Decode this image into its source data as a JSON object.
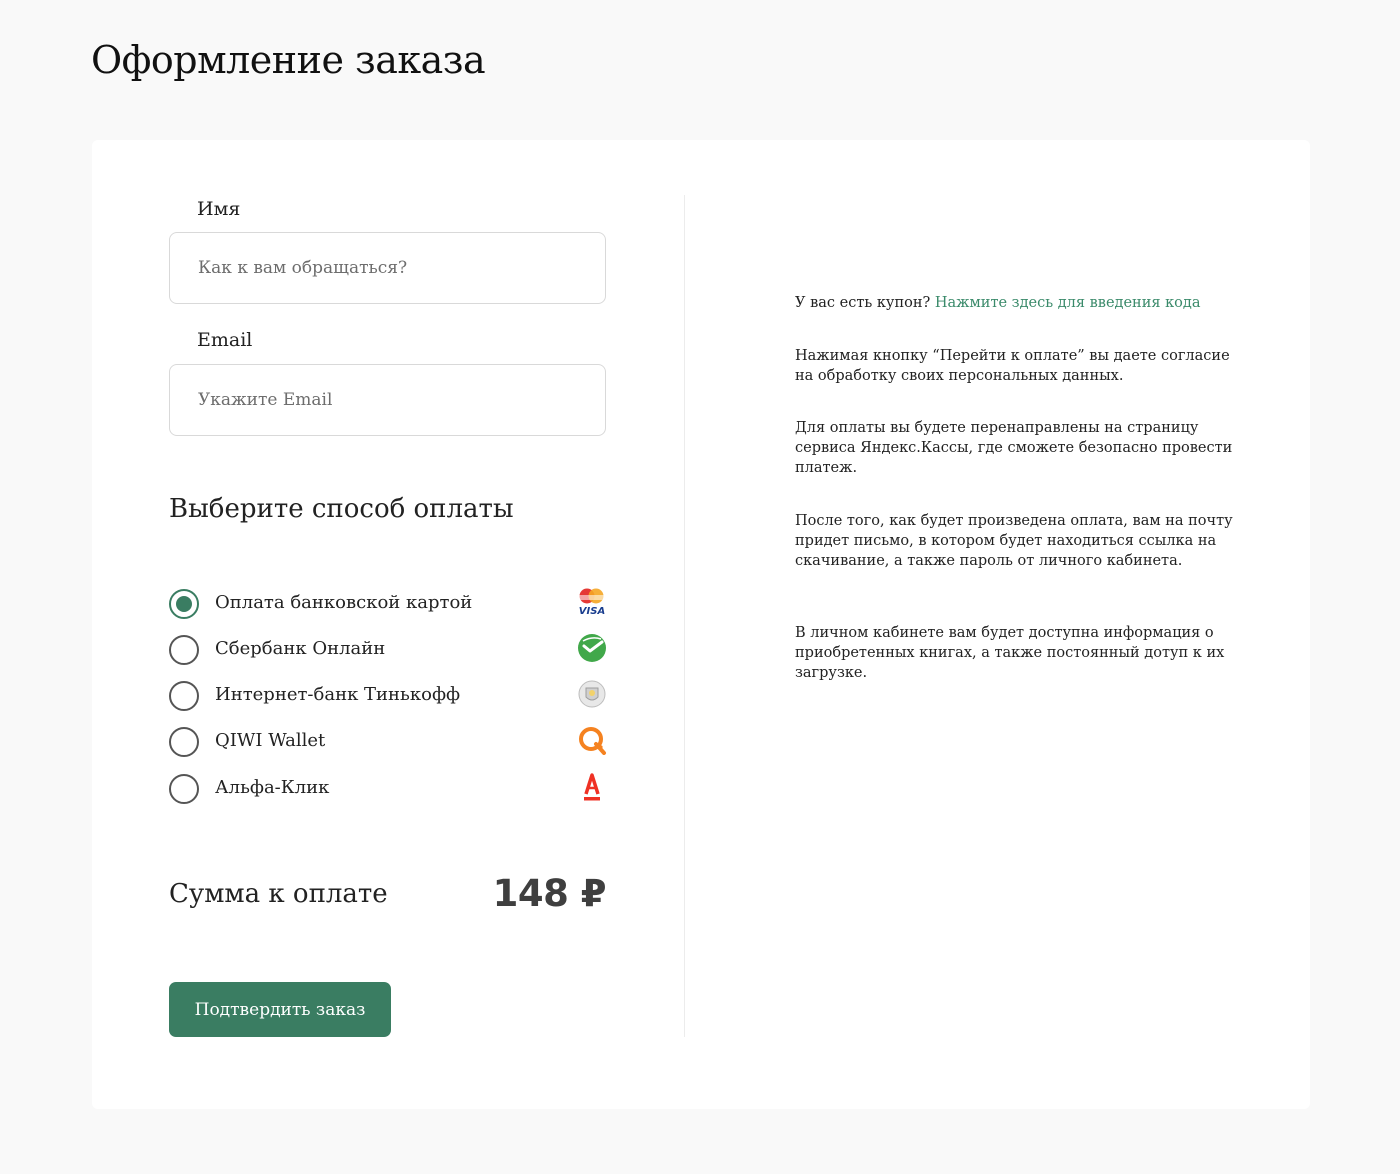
{
  "page": {
    "title": "Оформление заказа"
  },
  "form": {
    "name_label": "Имя",
    "name_placeholder": "Как к вам обращаться?",
    "name_value": "",
    "email_label": "Email",
    "email_placeholder": "Укажите Email",
    "email_value": ""
  },
  "payment": {
    "title": "Выберите способ оплаты",
    "selected_index": 0,
    "options": [
      {
        "label": "Оплата банковской картой",
        "icon": "mastercard-visa-icon"
      },
      {
        "label": "Сбербанк Онлайн",
        "icon": "sberbank-icon"
      },
      {
        "label": "Интернет-банк Тинькофф",
        "icon": "tinkoff-icon"
      },
      {
        "label": "QIWI Wallet",
        "icon": "qiwi-icon"
      },
      {
        "label": "Альфа-Клик",
        "icon": "alfa-bank-icon"
      }
    ]
  },
  "total": {
    "label": "Сумма к оплате",
    "value": "148 ₽"
  },
  "confirm_button_label": "Подтвердить заказ",
  "info": {
    "coupon_text": "У вас есть купон?",
    "coupon_link": "Нажмите здесь для введения кода",
    "paragraphs": [
      "Нажимая кнопку “Перейти к оплате” вы даете согласие на обработку своих персональных данных.",
      "Для оплаты вы будете перенаправлены на страницу сервиса Яндекс.Кассы, где сможете безопасно провести платеж.",
      "После того, как будет произведена оплата, вам на почту придет письмо, в котором будет находиться ссылка на скачивание, а также пароль от личного кабинета.",
      "В личном кабинете вам будет доступна информация о приобретенных книгах, а также постоянный дотуп к их загрузке."
    ]
  },
  "colors": {
    "accent": "#3a7d62",
    "link": "#3a8a6a",
    "page_background": "#f9f9f9",
    "card_background": "#ffffff"
  }
}
